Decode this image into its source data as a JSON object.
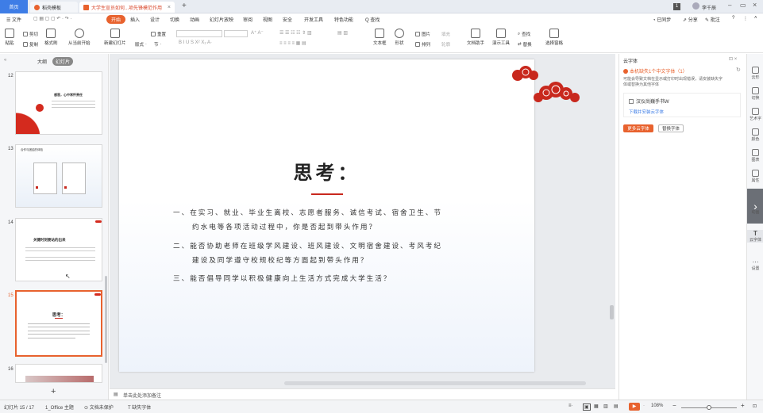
{
  "titlebar": {
    "home_tab": "首页",
    "tab1": "稻壳模板",
    "tab2": "大学生宣员如何...项先锋模范作用",
    "new_tab": "+",
    "page_num": "1",
    "user": "李千辰"
  },
  "menu": {
    "file": "☰ 文件",
    "items": [
      "开始",
      "插入",
      "设计",
      "切换",
      "动画",
      "幻灯片放映",
      "审阅",
      "视图",
      "安全",
      "开发工具",
      "特色功能"
    ],
    "search": "Q 查找",
    "sync": "已同步",
    "share": "分享",
    "comment": "批注"
  },
  "ribbon": {
    "paste": "粘贴",
    "cut": "剪切",
    "copy": "复制",
    "format_painter": "格式刷",
    "from_current": "从当前开始",
    "new_slide": "新建幻灯片",
    "layout": "版式",
    "section": "节",
    "reset": "重置",
    "textbox": "文本框",
    "shape": "形状",
    "arrange": "排列",
    "picture": "图片",
    "fill": "填充",
    "outline": "轮廓",
    "doc_helper": "文档助手",
    "presentation_tools": "演示工具",
    "find": "查找",
    "replace": "替换",
    "select_pane": "选择窗格"
  },
  "leftpanel": {
    "tab_outline": "大纲",
    "tab_slides": "幻灯片",
    "slides": [
      {
        "num": "12",
        "title": "感恩，心中常怀责任"
      },
      {
        "num": "13",
        "title": "合作与团结的体验"
      },
      {
        "num": "14",
        "title": "关键时刻要站的出来"
      },
      {
        "num": "15",
        "title": "思考："
      },
      {
        "num": "16",
        "title": ""
      }
    ],
    "add": "+"
  },
  "slide": {
    "title": "思考：",
    "q1_line1": "一、在实习、就业、毕业生离校、志愿者服务、诚信考试、宿舍卫生、节",
    "q1_line2": "约水电等各项活动过程中，你是否起到带头作用？",
    "q2_line1": "二、能否协助老师在班级学风建设、班风建设、文明宿舍建设、考风考纪",
    "q2_line2": "建设及同学遵守校规校纪等方面起到带头作用？",
    "q3": "三、能否倡导同学以积极健康向上生活方式完成大学生活？"
  },
  "notes": {
    "placeholder": "单击此处添加备注"
  },
  "cloudfont": {
    "header": "云字体",
    "warning": "本机缺失1个中文字体（1）",
    "desc1": "可能会导致文档在显示或打印时出现错误，请安装缺失字",
    "desc2": "体或替换为其他字体",
    "font_name": "汉仪尚巍手书W",
    "download_link": "下载并安装云字体",
    "more_btn": "更多云字体",
    "replace_btn": "替换字体"
  },
  "righttools": [
    "云形",
    "切换",
    "艺术字",
    "颜色",
    "图表",
    "属性",
    "",
    "动画",
    "云字体",
    "设置"
  ],
  "status": {
    "slide_pos": "幻灯片 15 / 17",
    "theme": "1_Office 主题",
    "protect": "文档未保护",
    "missing_font": "缺失字体",
    "zoom": "108%",
    "minus": "−",
    "plus": "+"
  },
  "colors": {
    "accent": "#e8622e",
    "blue": "#3e7de6",
    "red": "#c8281d"
  }
}
